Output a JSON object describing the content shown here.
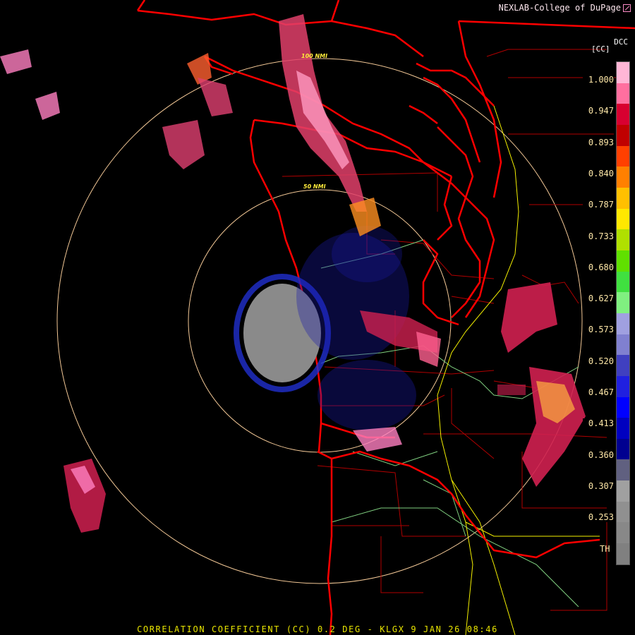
{
  "header": {
    "credit": "NEXLAB-College of DuPage",
    "credit_icon": "external-link-icon"
  },
  "legend": {
    "unit_top": "DCC",
    "unit": "[CC]",
    "ticks": [
      "1.000",
      "0.947",
      "0.893",
      "0.840",
      "0.787",
      "0.733",
      "0.680",
      "0.627",
      "0.573",
      "0.520",
      "0.467",
      "0.413",
      "0.360",
      "0.307",
      "0.253"
    ],
    "bottom_label": "TH",
    "colors": [
      "#ffb6d6",
      "#ff6f9f",
      "#d80030",
      "#c00000",
      "#ff4000",
      "#ff8000",
      "#ffc000",
      "#ffe800",
      "#b0e000",
      "#60e000",
      "#40e040",
      "#80f080",
      "#a0a0e0",
      "#8080d0",
      "#4040c0",
      "#2020e0",
      "#0000ff",
      "#0000c0",
      "#000090",
      "#606080",
      "#a0a0a0",
      "#909090",
      "#888888",
      "#808080"
    ]
  },
  "map": {
    "range_rings": [
      "50 NMI",
      "100 NMI"
    ],
    "colors": {
      "state_border": "#ff0000",
      "county_border": "#b00000",
      "road": "#f4f000",
      "river": "#80d080",
      "range_ring": "#f3c896"
    }
  },
  "footer": {
    "title": "CORRELATION COEFFICIENT (CC) 0.2 DEG - KLGX 9 JAN 26 08:46"
  }
}
